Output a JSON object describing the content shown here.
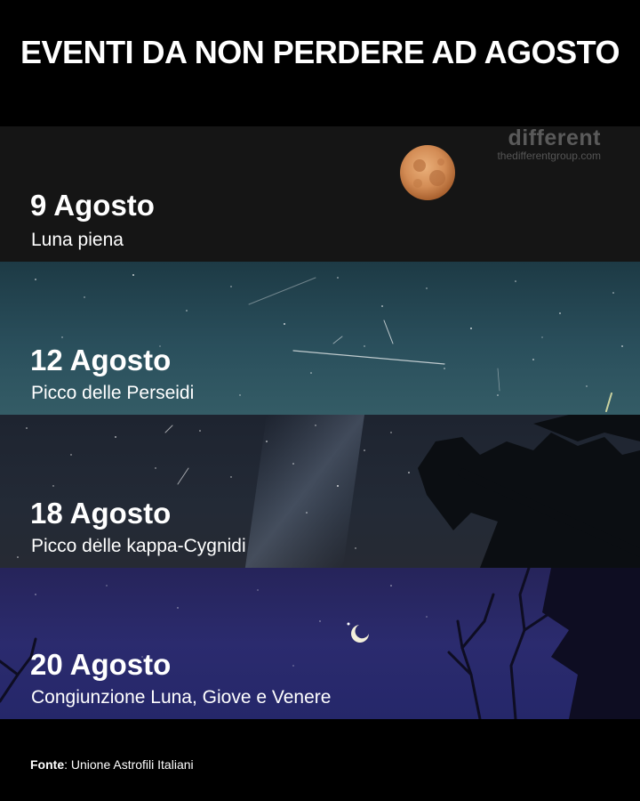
{
  "title": "EVENTI DA NON PERDERE AD AGOSTO",
  "brand": {
    "name": "different",
    "url": "thedifferentgroup.com"
  },
  "events": [
    {
      "date": "9 Agosto",
      "description": "Luna piena",
      "illustration": "full-moon"
    },
    {
      "date": "12 Agosto",
      "description": "Picco delle Perseidi",
      "illustration": "meteor-shower"
    },
    {
      "date": "18 Agosto",
      "description": "Picco delle kappa-Cygnidi",
      "illustration": "milky-way-trees"
    },
    {
      "date": "20 Agosto",
      "description": "Congiunzione Luna, Giove e Venere",
      "illustration": "crescent-moon"
    }
  ],
  "footer": {
    "label": "Fonte",
    "text": ": Unione Astrofili Italiani"
  },
  "colors": {
    "background": "#000000",
    "moon": "#d8905a",
    "panel2": "#2a4f5c",
    "panel3": "#232a36",
    "panel4": "#2b2b6e"
  }
}
